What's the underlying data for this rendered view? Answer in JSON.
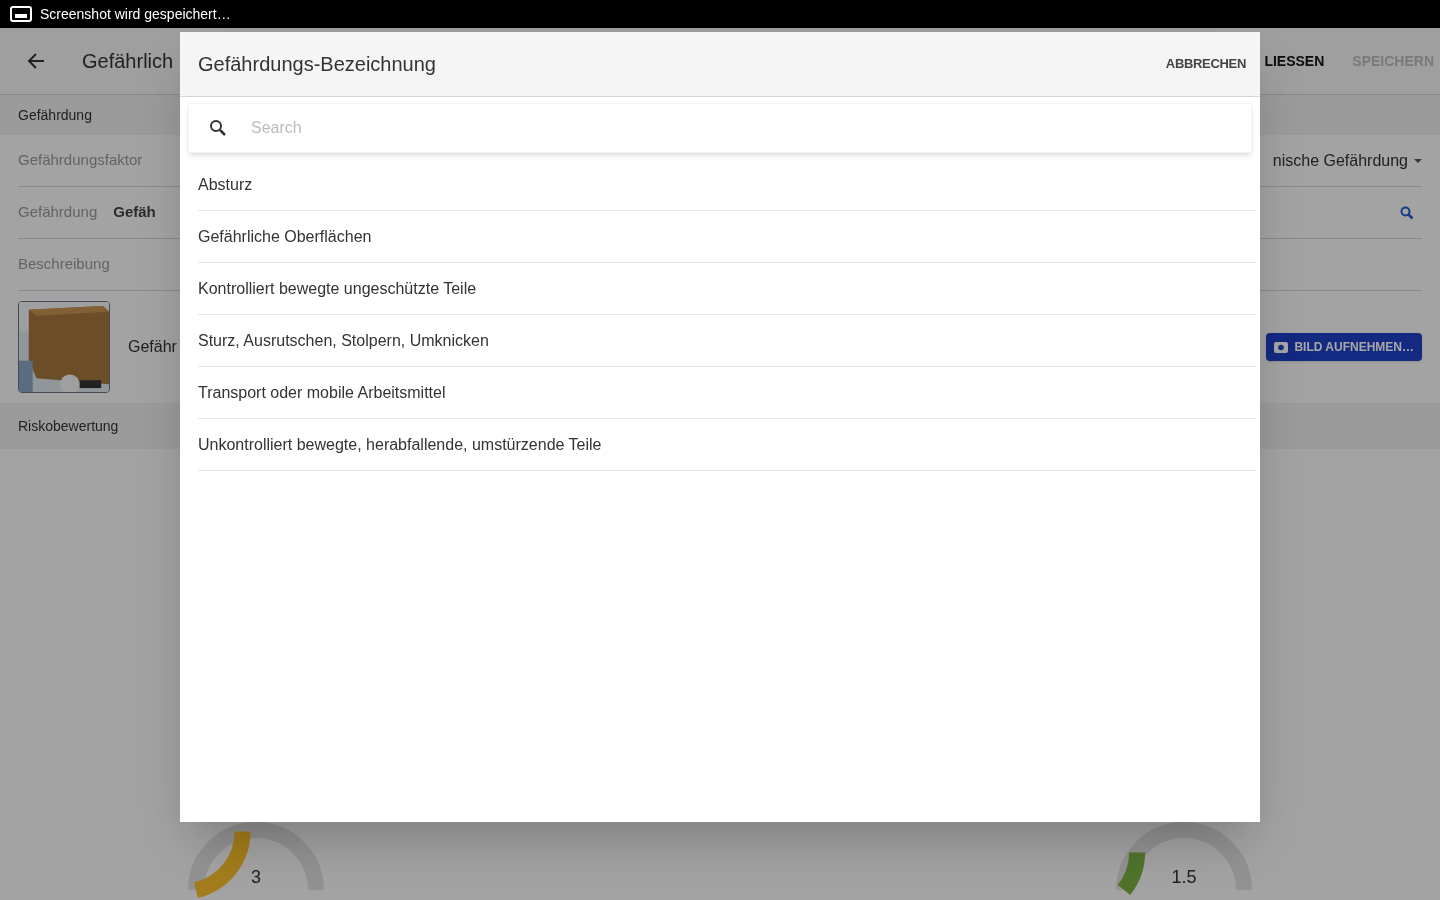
{
  "status_bar": {
    "notification": "Screenshot wird gespeichert…"
  },
  "app_bar": {
    "title": "Gefährlich",
    "actions": [
      {
        "label": "LIESSEN",
        "disabled": false
      },
      {
        "label": "SPEICHERN",
        "disabled": true
      }
    ]
  },
  "form": {
    "section": "Gefährdung",
    "rows": [
      {
        "kind": "dropdown",
        "label": "Gefährdungsfaktor",
        "value": "nische Gefährdung"
      },
      {
        "kind": "search",
        "label": "Gefährdung",
        "value": "Gefäh"
      },
      {
        "kind": "text",
        "label": "Beschreibung"
      }
    ],
    "photo": {
      "caption": "Gefähr",
      "button": "BILD AUFNEHMEN…"
    },
    "risk_section": "Riskobewertung"
  },
  "gauges": [
    {
      "reading": "3"
    },
    {
      "reading": "1.5"
    }
  ],
  "dialog": {
    "title": "Gefährdungs-Bezeichnung",
    "cancel": "ABBRECHEN",
    "search": {
      "placeholder": "Search"
    },
    "items": [
      "Absturz",
      "Gefährliche Oberflächen",
      "Kontrolliert bewegte ungeschützte Teile",
      "Sturz, Ausrutschen, Stolpern, Umknicken",
      "Transport oder mobile Arbeitsmittel",
      "Unkontrolliert bewegte, herabfallende, umstürzende Teile"
    ]
  }
}
